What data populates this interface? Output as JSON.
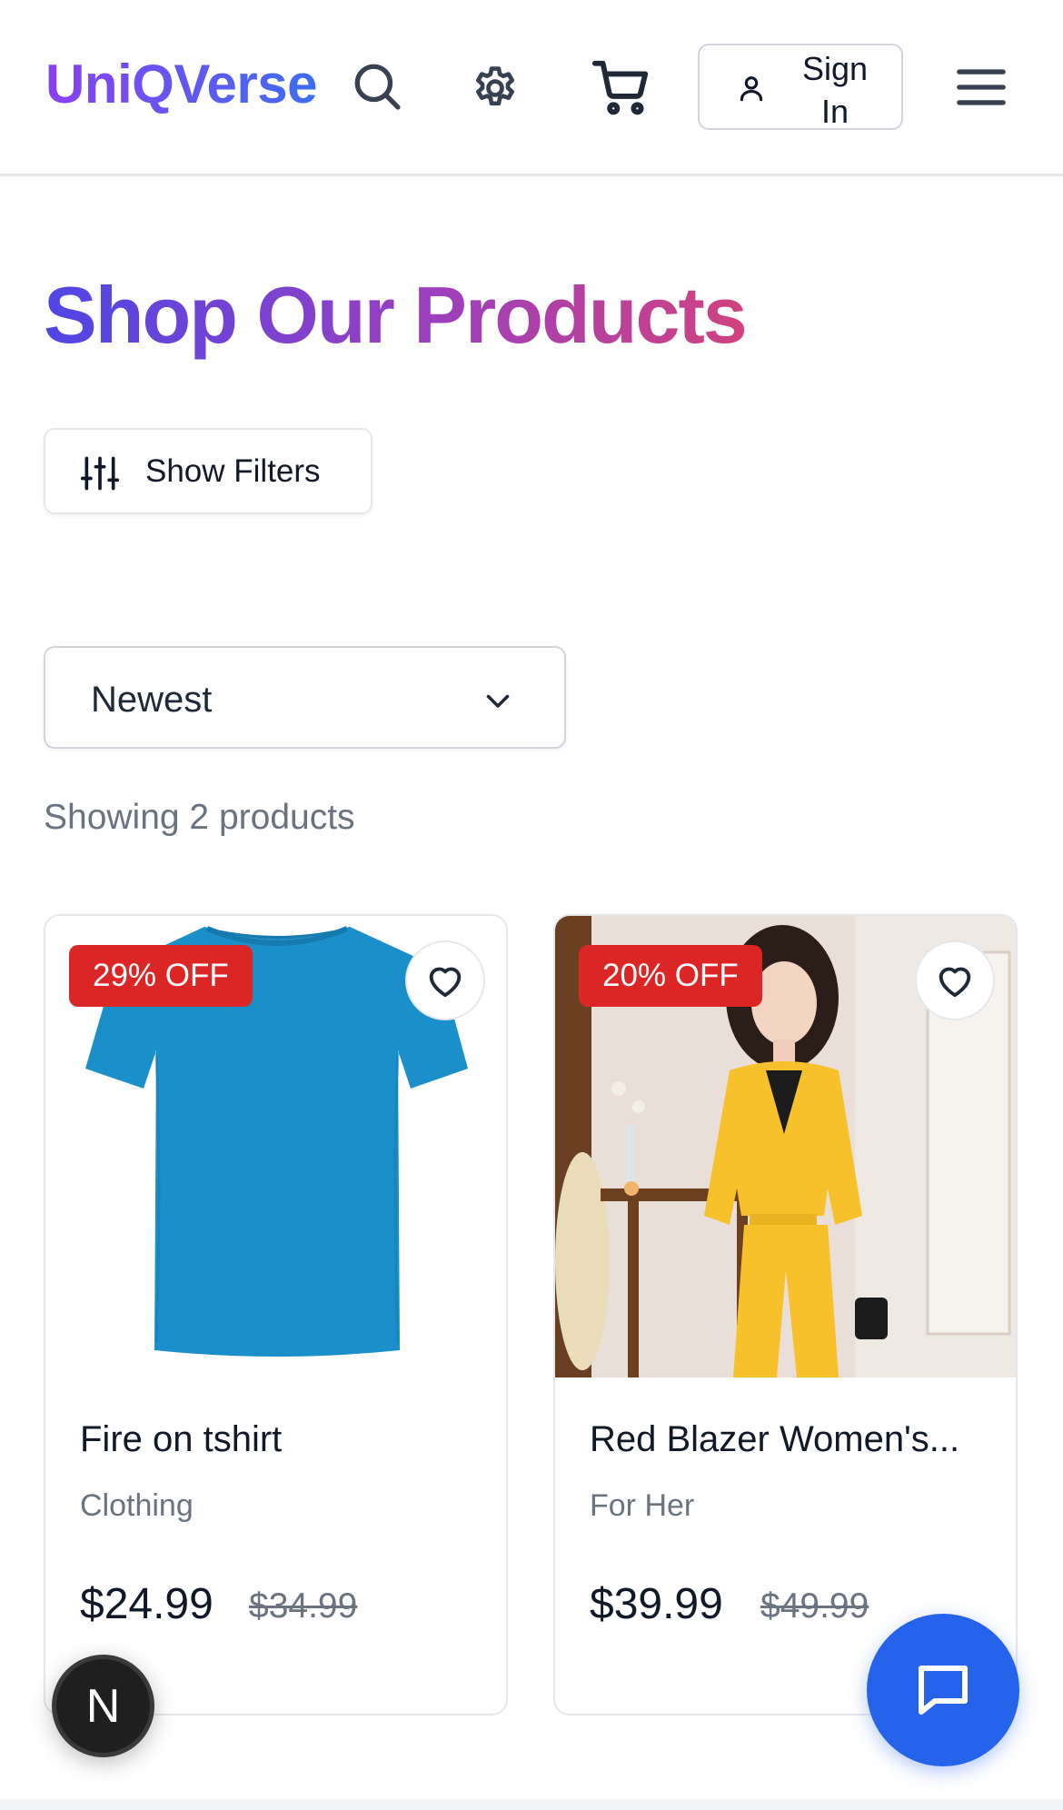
{
  "brand": {
    "name": "UniQVerse"
  },
  "header": {
    "signin_label": "Sign In",
    "icons": [
      "search-icon",
      "gear-icon",
      "cart-icon",
      "user-icon",
      "menu-icon"
    ]
  },
  "main": {
    "title": "Shop Our Products",
    "filters_label": "Show Filters",
    "sort": {
      "selected": "Newest"
    },
    "result_count": "Showing 2 products"
  },
  "products": [
    {
      "name": "Fire on tshirt",
      "category": "Clothing",
      "price": "$24.99",
      "original_price": "$34.99",
      "discount": "29% OFF",
      "image_color": "#1c8ec9"
    },
    {
      "name": "Red Blazer Women's...",
      "category": "For Her",
      "price": "$39.99",
      "original_price": "$49.99",
      "discount": "20% OFF",
      "image_color": "#f2c12e"
    }
  ],
  "floating": {
    "dev_badge": "N"
  },
  "colors": {
    "brand_gradient_start": "#8b3ff0",
    "brand_gradient_end": "#3d6ef0",
    "badge_red": "#dc2626",
    "chat_blue": "#2563eb"
  }
}
